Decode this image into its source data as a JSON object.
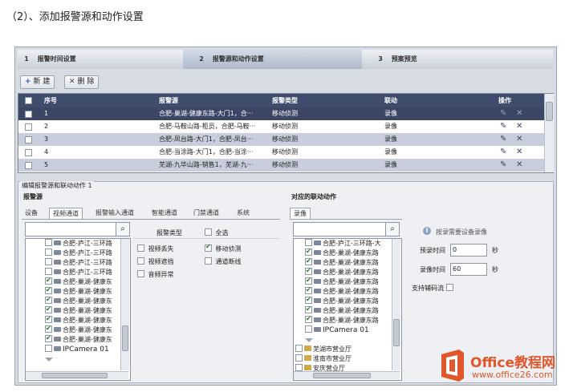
{
  "heading": "（2）、添加报警源和动作设置",
  "wizard": {
    "steps": [
      {
        "num": "1",
        "label": "报警时间设置"
      },
      {
        "num": "2",
        "label": "报警源和动作设置"
      },
      {
        "num": "3",
        "label": "预案预览"
      }
    ]
  },
  "toolbar": {
    "new_label": "新 建",
    "new_icon": "+",
    "delete_label": "删 除",
    "delete_icon": "✕"
  },
  "table": {
    "headers": {
      "seq": "序号",
      "source": "报警源",
      "type": "报警类型",
      "linkage": "联动",
      "ops": "操作"
    },
    "rows": [
      {
        "seq": "1",
        "source": "合肥-巢湖-健康东路-大门1，合···",
        "type": "移动侦测",
        "linkage": "录像"
      },
      {
        "seq": "2",
        "source": "合肥-马鞍山路-柜员，合肥-马鞍···",
        "type": "移动侦测",
        "linkage": "录像"
      },
      {
        "seq": "3",
        "source": "合肥-凤台路-大门1，合肥-凤台···",
        "type": "移动侦测",
        "linkage": "录像"
      },
      {
        "seq": "4",
        "source": "合肥-当涂路-大门1，合肥-当涂···",
        "type": "移动侦测",
        "linkage": "录像"
      },
      {
        "seq": "5",
        "source": "芜湖-九华山路-销售1，芜湖-九···",
        "type": "移动侦测",
        "linkage": "录像"
      }
    ],
    "edit_icon": "✎",
    "delete_icon": "✕"
  },
  "edit": {
    "title": "编辑报警源和联动动作 1",
    "source_title": "报警源",
    "source_tabs": [
      "设备",
      "视频通道",
      "报警输入通道",
      "智能通道",
      "门禁通道",
      "系统"
    ],
    "search_icon": "🔍",
    "channels": [
      {
        "label": "合肥-庐江-三环路",
        "checked": false
      },
      {
        "label": "合肥-庐江-三环路",
        "checked": false
      },
      {
        "label": "合肥-庐江-三环路",
        "checked": false
      },
      {
        "label": "合肥-庐江-三环路",
        "checked": false
      },
      {
        "label": "合肥-巢湖-健康东",
        "checked": true
      },
      {
        "label": "合肥-巢湖-健康东",
        "checked": true
      },
      {
        "label": "合肥-巢湖-健康东",
        "checked": true
      },
      {
        "label": "合肥-巢湖-健康东",
        "checked": true
      },
      {
        "label": "合肥-巢湖-健康东",
        "checked": true
      },
      {
        "label": "合肥-巢湖-健康东",
        "checked": true
      },
      {
        "label": "合肥-巢湖-健康东",
        "checked": true
      },
      {
        "label": "IPCamera 01",
        "checked": false
      }
    ],
    "alarm_types_title": "报警类型",
    "select_all": "全选",
    "alarm_types": [
      {
        "label": "视频丢失",
        "checked": false
      },
      {
        "label": "移动侦测",
        "checked": true
      },
      {
        "label": "视频遮挡",
        "checked": false
      },
      {
        "label": "通道断线",
        "checked": false
      },
      {
        "label": "音频异常",
        "checked": false
      }
    ],
    "linkage_title": "对应的联动动作",
    "linkage_tab": "录像",
    "linkage_channels": [
      {
        "label": "合肥-庐江-三环路-大",
        "checked": false
      },
      {
        "label": "合肥-巢湖-健康东路",
        "checked": true
      },
      {
        "label": "合肥-巢湖-健康东路",
        "checked": true
      },
      {
        "label": "合肥-巢湖-健康东路",
        "checked": true
      },
      {
        "label": "合肥-巢湖-健康东路",
        "checked": true
      },
      {
        "label": "合肥-巢湖-健康东路",
        "checked": true
      },
      {
        "label": "合肥-巢湖-健康东路",
        "checked": true
      },
      {
        "label": "合肥-巢湖-健康东路",
        "checked": true
      },
      {
        "label": "合肥-巢湖-健康东路",
        "checked": true
      },
      {
        "label": "IPCamera 01",
        "checked": false
      }
    ],
    "linkage_groups": [
      "芜湖市营业厅",
      "淮南市营业厅",
      "安庆营业厅"
    ],
    "info_icon": "i",
    "info_text": "按录需要设备录像",
    "pre_record_label": "预录时间",
    "pre_record_value": "0",
    "record_label": "录像时间",
    "record_value": "60",
    "unit": "秒",
    "stream_label": "支持辅码流"
  },
  "watermark": {
    "brand": "Office教程网",
    "url": "www.office26.com"
  }
}
